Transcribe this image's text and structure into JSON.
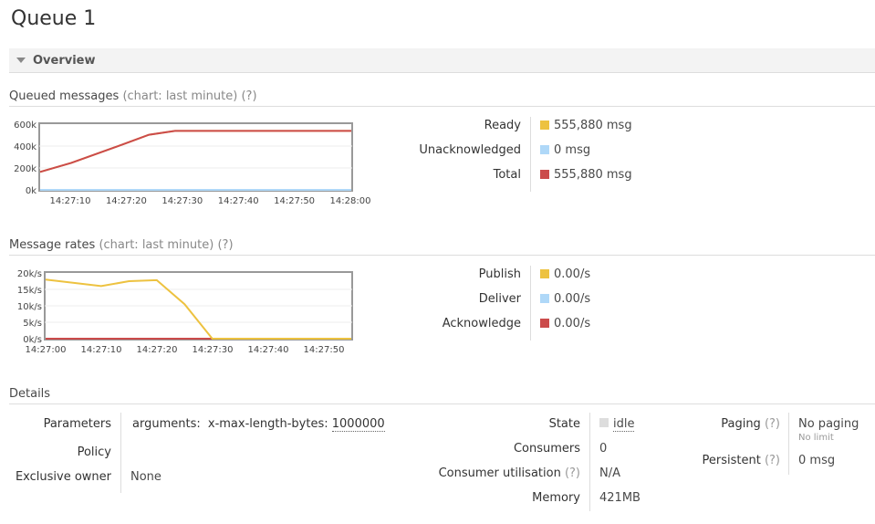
{
  "page": {
    "title": "Queue 1"
  },
  "overview": {
    "label": "Overview"
  },
  "queued": {
    "heading": "Queued messages",
    "chart_note": "(chart: last minute)",
    "help": "(?)",
    "legend": [
      {
        "name": "Ready",
        "value": "555,880 msg",
        "color": "#edc240"
      },
      {
        "name": "Unacknowledged",
        "value": "0 msg",
        "color": "#afd8f8"
      },
      {
        "name": "Total",
        "value": "555,880 msg",
        "color": "#cb4b4b"
      }
    ]
  },
  "rates": {
    "heading": "Message rates",
    "chart_note": "(chart: last minute)",
    "help": "(?)",
    "legend": [
      {
        "name": "Publish",
        "value": "0.00/s",
        "color": "#edc240"
      },
      {
        "name": "Deliver",
        "value": "0.00/s",
        "color": "#afd8f8"
      },
      {
        "name": "Acknowledge",
        "value": "0.00/s",
        "color": "#cb4b4b"
      }
    ]
  },
  "details": {
    "heading": "Details",
    "parameters_label": "Parameters",
    "parameters_key": "arguments:",
    "parameters_arg": "x-max-length-bytes:",
    "parameters_value": "1000000",
    "policy_label": "Policy",
    "exclusive_owner_label": "Exclusive owner",
    "exclusive_owner_value": "None",
    "state_label": "State",
    "state_value": "idle",
    "consumers_label": "Consumers",
    "consumers_value": "0",
    "consumer_util_label": "Consumer utilisation",
    "consumer_util_help": "(?)",
    "consumer_util_value": "N/A",
    "memory_label": "Memory",
    "memory_value": "421MB",
    "paging_label": "Paging",
    "paging_help": "(?)",
    "paging_value": "No paging",
    "paging_sub": "No limit",
    "persistent_label": "Persistent",
    "persistent_help": "(?)",
    "persistent_value": "0 msg"
  },
  "chart_data": [
    {
      "type": "line",
      "title": "Queued messages",
      "x": [
        "14:27:04",
        "14:27:10",
        "14:27:20",
        "14:27:30",
        "14:28:00"
      ],
      "xticks": [
        "14:27:10",
        "14:27:20",
        "14:27:30",
        "14:27:40",
        "14:27:50",
        "14:28:00"
      ],
      "yticks": [
        "0k",
        "200k",
        "400k",
        "600k"
      ],
      "ylim": [
        0,
        620000
      ],
      "series": [
        {
          "name": "Ready",
          "color": "#edc240",
          "points": [
            [
              0,
              170000
            ],
            [
              6,
              255000
            ],
            [
              16,
              430000
            ],
            [
              21,
              520000
            ],
            [
              26,
              555880
            ],
            [
              60,
              555880
            ]
          ]
        },
        {
          "name": "Unacknowledged",
          "color": "#afd8f8",
          "points": [
            [
              0,
              0
            ],
            [
              60,
              0
            ]
          ]
        },
        {
          "name": "Total",
          "color": "#cb4b4b",
          "points": [
            [
              0,
              170000
            ],
            [
              6,
              255000
            ],
            [
              16,
              430000
            ],
            [
              21,
              520000
            ],
            [
              26,
              555880
            ],
            [
              60,
              555880
            ]
          ]
        }
      ]
    },
    {
      "type": "line",
      "title": "Message rates",
      "x": [
        "14:27:00",
        "14:27:50"
      ],
      "xticks": [
        "14:27:00",
        "14:27:10",
        "14:27:20",
        "14:27:30",
        "14:27:40",
        "14:27:50"
      ],
      "yticks": [
        "0k/s",
        "5k/s",
        "10k/s",
        "15k/s",
        "20k/s"
      ],
      "ylim": [
        0,
        20000
      ],
      "series": [
        {
          "name": "Publish",
          "color": "#edc240",
          "points": [
            [
              0,
              18000
            ],
            [
              10,
              16000
            ],
            [
              15,
              17500
            ],
            [
              20,
              17800
            ],
            [
              25,
              10500
            ],
            [
              30,
              0
            ],
            [
              55,
              0
            ]
          ]
        },
        {
          "name": "Deliver",
          "color": "#afd8f8",
          "points": [
            [
              0,
              0
            ],
            [
              55,
              0
            ]
          ]
        },
        {
          "name": "Acknowledge",
          "color": "#cb4b4b",
          "points": [
            [
              0,
              0
            ],
            [
              55,
              0
            ]
          ]
        }
      ]
    }
  ]
}
